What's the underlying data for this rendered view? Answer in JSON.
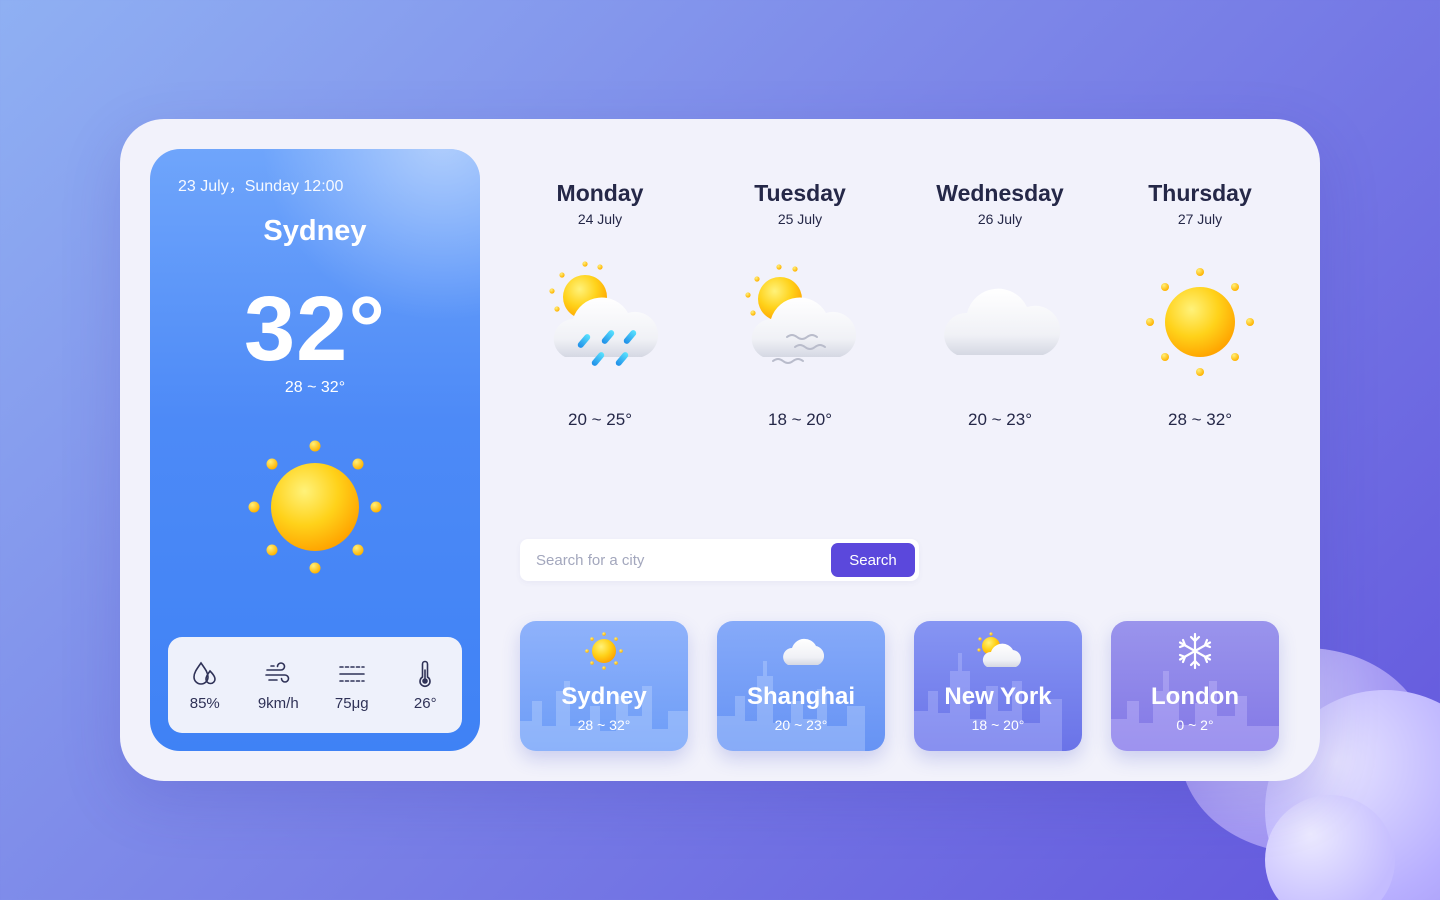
{
  "today": {
    "datetime": "23 July，Sunday 12:00",
    "city": "Sydney",
    "temperature": "32°",
    "range": "28 ~ 32°",
    "icon": "sun-icon",
    "stats": [
      {
        "icon": "humidity-icon",
        "value": "85%"
      },
      {
        "icon": "wind-icon",
        "value": "9km/h"
      },
      {
        "icon": "haze-icon",
        "value": "75μg"
      },
      {
        "icon": "thermometer-icon",
        "value": "26°"
      }
    ]
  },
  "forecast": [
    {
      "day": "Monday",
      "date": "24 July",
      "icon": "sun-cloud-rain-icon",
      "range": "20 ~ 25°"
    },
    {
      "day": "Tuesday",
      "date": "25 July",
      "icon": "sun-cloud-wind-icon",
      "range": "18 ~ 20°"
    },
    {
      "day": "Wednesday",
      "date": "26 July",
      "icon": "cloud-icon",
      "range": "20 ~ 23°"
    },
    {
      "day": "Thursday",
      "date": "27 July",
      "icon": "sun-icon",
      "range": "28 ~ 32°"
    }
  ],
  "search": {
    "placeholder": "Search for a city",
    "button_label": "Search"
  },
  "cities": [
    {
      "name": "Sydney",
      "range": "28 ~ 32°",
      "icon": "sun-icon"
    },
    {
      "name": "Shanghai",
      "range": "20 ~ 23°",
      "icon": "cloud-icon"
    },
    {
      "name": "New York",
      "range": "18 ~ 20°",
      "icon": "sun-cloud-icon"
    },
    {
      "name": "London",
      "range": "0 ~ 2°",
      "icon": "snowflake-icon"
    }
  ],
  "colors": {
    "accent": "#5b48dc",
    "today_card": "#4d8af7",
    "text_dark": "#252848",
    "sun": "#ffc107"
  }
}
